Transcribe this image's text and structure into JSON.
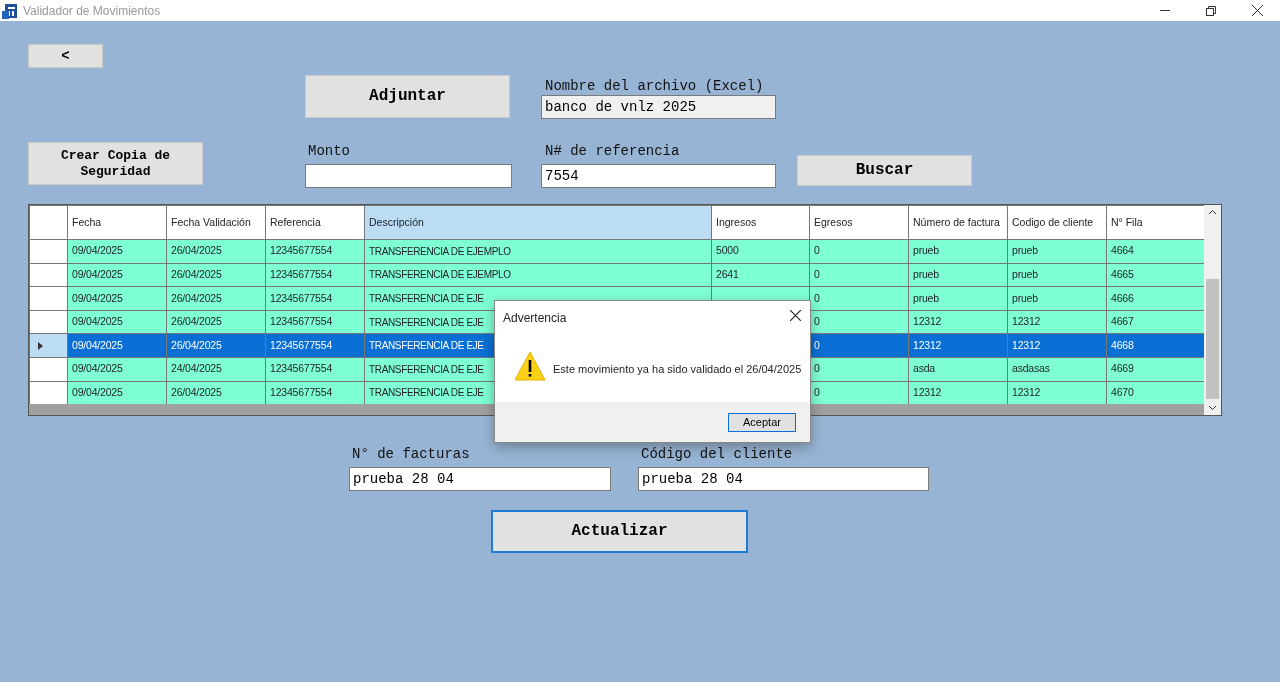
{
  "window": {
    "title": "Validador de Movimientos"
  },
  "back_button": "<",
  "attach_button": "Adjuntar",
  "file_name": {
    "label": "Nombre del archivo (Excel)",
    "value": "banco de vnlz 2025",
    "readonly": true
  },
  "backup_button": "Crear Copia de Seguridad",
  "amount": {
    "label": "Monto"
  },
  "reference": {
    "label": "N# de referencia",
    "value": "7554"
  },
  "search_button": "Buscar",
  "table": {
    "columns": [
      {
        "label": "Fecha",
        "highlighted": false
      },
      {
        "label": "Fecha Validación",
        "highlighted": false
      },
      {
        "label": "Referencia",
        "highlighted": false
      },
      {
        "label": "Descripción",
        "highlighted": true
      },
      {
        "label": "Ingresos",
        "highlighted": false
      },
      {
        "label": "Egresos",
        "highlighted": false
      },
      {
        "label": "Número de factura",
        "highlighted": false
      },
      {
        "label": "Codigo de cliente",
        "highlighted": false
      },
      {
        "label": "N° Fila",
        "highlighted": false
      }
    ],
    "rows": [
      {
        "selected": false,
        "cells": [
          "09/04/2025",
          "26/04/2025",
          "12345677554",
          "TRANSFERENCIA DE EJEMPLO",
          "5000",
          "0",
          "prueb",
          "prueb",
          "4664"
        ]
      },
      {
        "selected": false,
        "cells": [
          "09/04/2025",
          "26/04/2025",
          "12345677554",
          "TRANSFERENCIA DE EJEMPLO",
          "2641",
          "0",
          "prueb",
          "prueb",
          "4665"
        ]
      },
      {
        "selected": false,
        "cells": [
          "09/04/2025",
          "26/04/2025",
          "12345677554",
          "TRANSFERENCIA DE EJE",
          null,
          "0",
          "prueb",
          "prueb",
          "4666"
        ]
      },
      {
        "selected": false,
        "cells": [
          "09/04/2025",
          "26/04/2025",
          "12345677554",
          "TRANSFERENCIA DE EJE",
          null,
          "0",
          "12312",
          "12312",
          "4667"
        ]
      },
      {
        "selected": true,
        "cells": [
          "09/04/2025",
          "26/04/2025",
          "12345677554",
          "TRANSFERENCIA DE EJE",
          null,
          "0",
          "12312",
          "12312",
          "4668"
        ]
      },
      {
        "selected": false,
        "cells": [
          "09/04/2025",
          "24/04/2025",
          "12345677554",
          "TRANSFERENCIA DE EJE",
          null,
          "0",
          "asda",
          "asdasas",
          "4669"
        ]
      },
      {
        "selected": false,
        "cells": [
          "09/04/2025",
          "26/04/2025",
          "12345677554",
          "TRANSFERENCIA DE EJE",
          null,
          "0",
          "12312",
          "12312",
          "4670"
        ]
      }
    ]
  },
  "invoice": {
    "label": "N° de facturas",
    "value": "prueba 28 04"
  },
  "client_code": {
    "label": "Código del cliente",
    "value": "prueba 28 04"
  },
  "update_button": {
    "label": "Actualizar",
    "focused": true
  },
  "dialog": {
    "title": "Advertencia",
    "message": "Este movimiento ya ha sido validado el 26/04/2025",
    "button": "Aceptar"
  }
}
